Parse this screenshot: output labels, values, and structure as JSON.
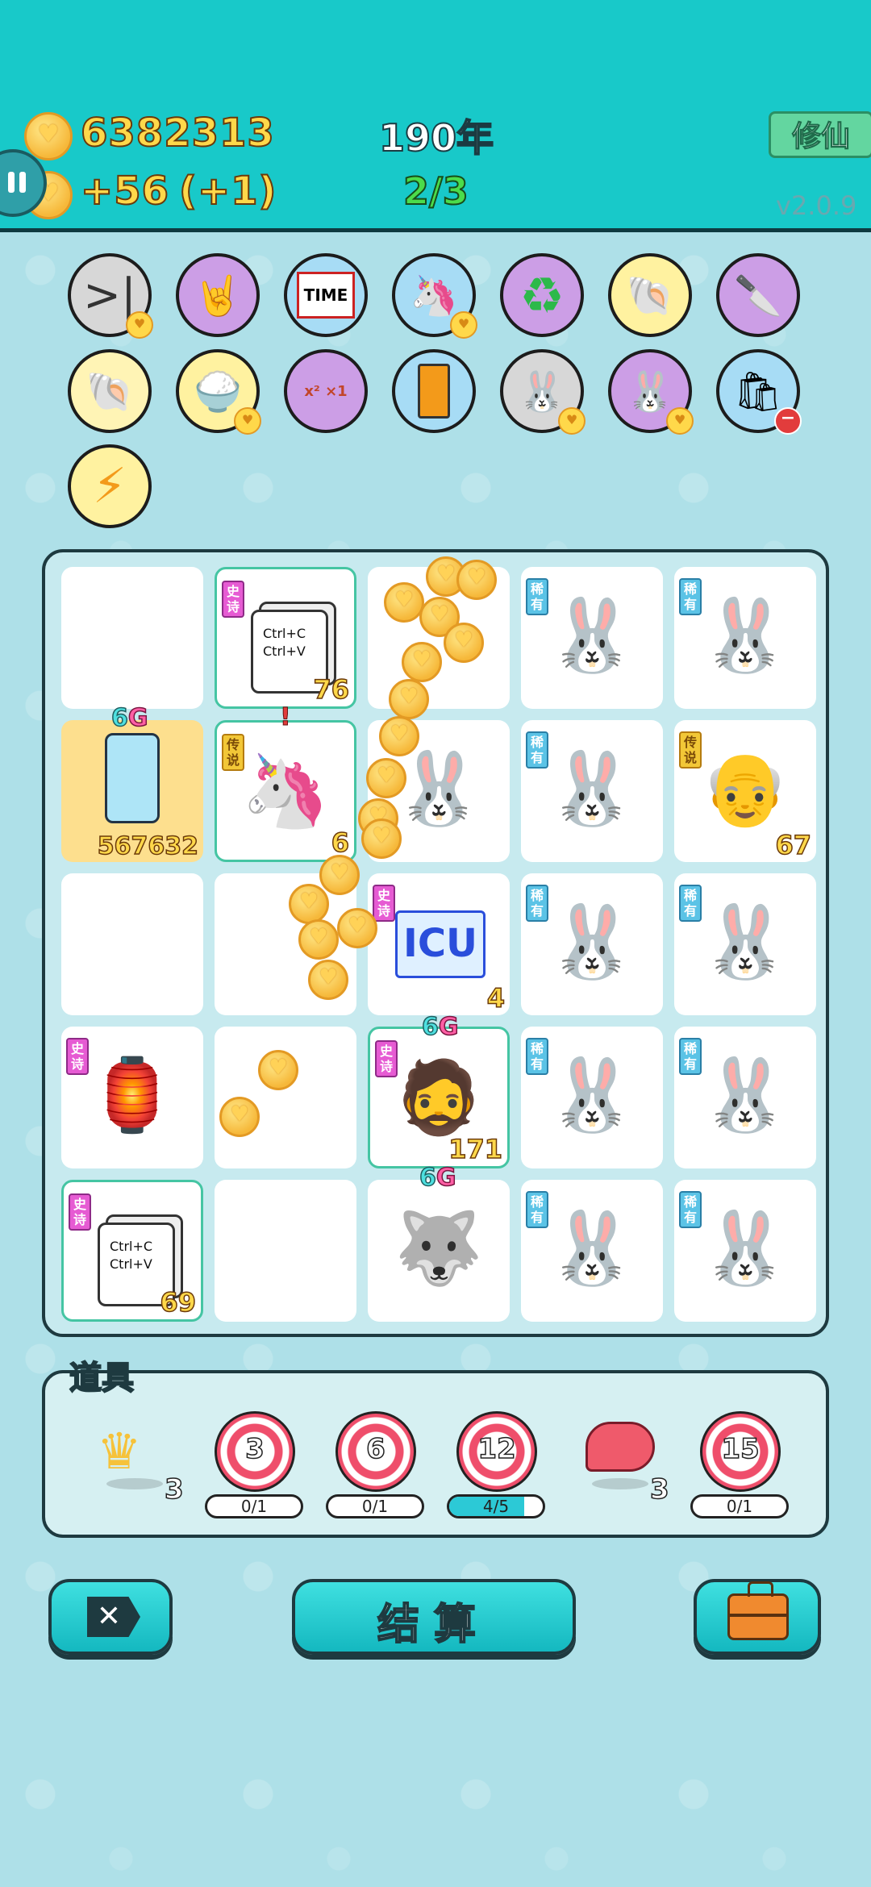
{
  "header": {
    "coins": "6382313",
    "income": "+56",
    "income_bonus": "(+1)",
    "year": "190年",
    "round": "2/3",
    "cultivate_label": "修仙",
    "version": "v2.0.9"
  },
  "board": {
    "copy_paste_text": "Ctrl+C\nCtrl+V",
    "icu_label": "ICU",
    "rarity": {
      "rare": "稀有",
      "epic": "史诗",
      "legend": "传说"
    },
    "badge_prefix": "6",
    "badge_suffix": "G",
    "counts": {
      "copy_top": "76",
      "fridge": "567632",
      "unicorn": "6",
      "old_man": "67",
      "icu": "4",
      "grandpa": "171",
      "copy_bottom": "69"
    },
    "sparks": "!"
  },
  "props": {
    "title": "道具",
    "crown_count": "3",
    "liver_count": "3",
    "targets": [
      {
        "value": "3",
        "progress": "0/1",
        "ratio": 0
      },
      {
        "value": "6",
        "progress": "0/1",
        "ratio": 0
      },
      {
        "value": "12",
        "progress": "4/5",
        "ratio": 0.8
      },
      {
        "value": "15",
        "progress": "0/1",
        "ratio": 0
      }
    ]
  },
  "buttons": {
    "settle": "结算",
    "exit_symbol": "✕"
  },
  "colors": {
    "header_bg": "#18c9c9",
    "page_bg": "#aee0e8",
    "coin_text": "#ffd84a",
    "round_text": "#4bdc4b"
  }
}
